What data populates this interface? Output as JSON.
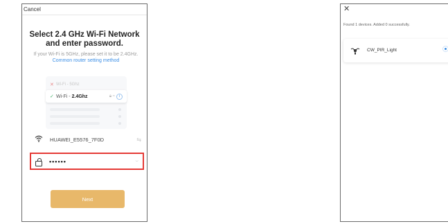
{
  "left": {
    "cancel_label": "Cancel",
    "title_line1": "Select 2.4 GHz Wi-Fi Network",
    "title_line2": "and enter password.",
    "subtitle": "If your Wi-Fi is 5GHz, please set it to be 2.4GHz.",
    "subtitle_link": "Common router setting method",
    "illustration": {
      "row_5g_label": "Wi-Fi - 5Ghz",
      "row_24_prefix": "Wi-Fi - ",
      "row_24_bold": "2.4Ghz"
    },
    "ssid": "HUAWEI_E5576_7F0D",
    "password_value": "••••••",
    "next_label": "Next"
  },
  "right": {
    "found_text": "Found 1 devices. Added 0 successfully.",
    "device_name": "CW_PIR_Light"
  },
  "icons": {
    "close": "close-icon",
    "wifi": "wifi-icon",
    "lock": "lock-icon",
    "swap": "swap-icon",
    "eye": "eye-hidden-icon",
    "device": "lamp-icon",
    "status": "loading-icon"
  },
  "colors": {
    "accent_link": "#3a8ee6",
    "next_button": "#e8b86a",
    "highlight_border": "#e53935",
    "check_green": "#49b36b"
  }
}
